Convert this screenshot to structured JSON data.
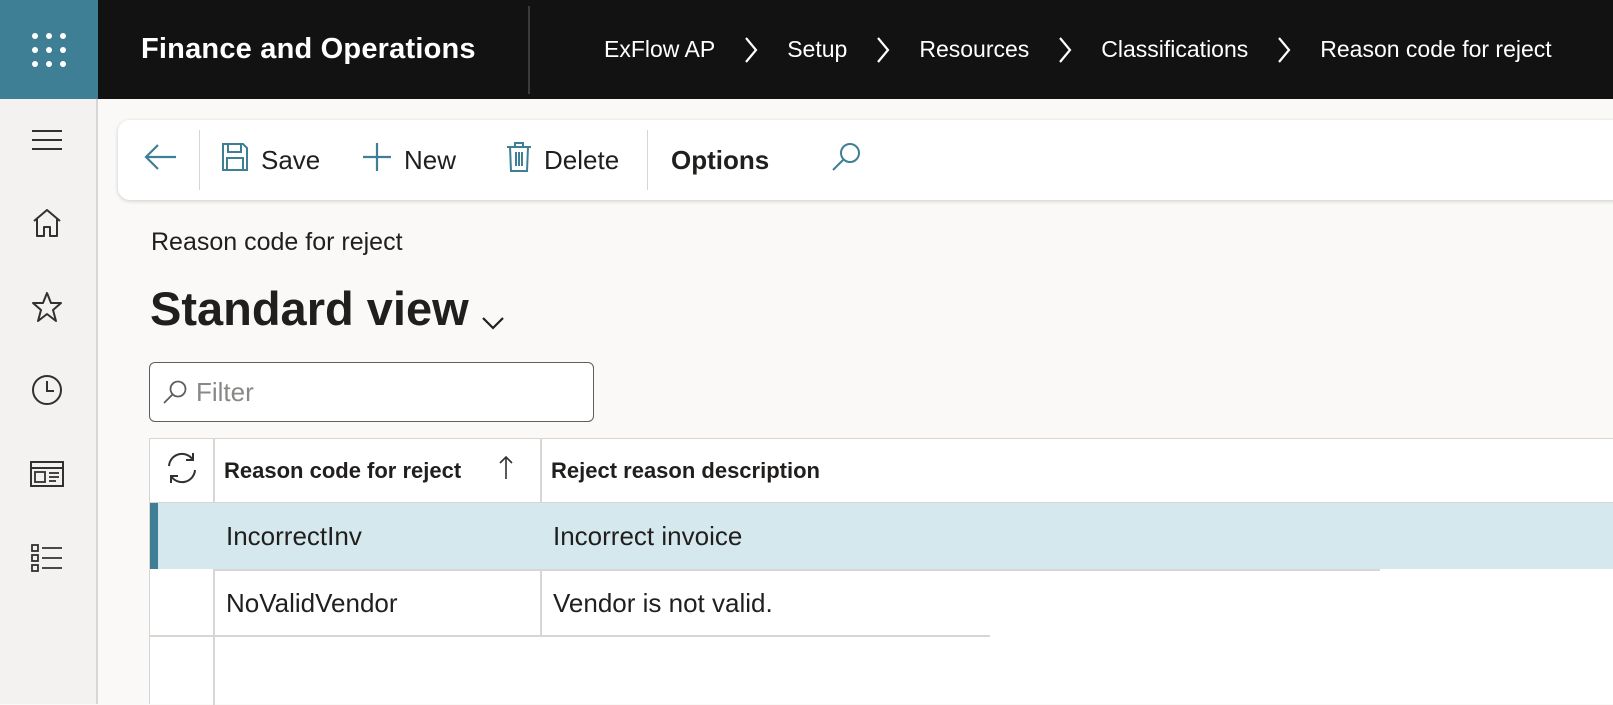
{
  "header": {
    "app_title": "Finance and Operations",
    "breadcrumb": [
      "ExFlow AP",
      "Setup",
      "Resources",
      "Classifications",
      "Reason code for reject"
    ]
  },
  "leftnav": {
    "items": [
      "hamburger-icon",
      "home-icon",
      "star-icon",
      "clock-icon",
      "workspace-icon",
      "modules-icon"
    ]
  },
  "actions": {
    "back_icon": "back-arrow-icon",
    "save_label": "Save",
    "new_label": "New",
    "delete_label": "Delete",
    "options_label": "Options",
    "search_icon": "search-icon"
  },
  "page": {
    "subtitle": "Reason code for reject",
    "view_title": "Standard view"
  },
  "filter": {
    "placeholder": "Filter",
    "value": ""
  },
  "grid": {
    "columns": [
      "Reason code for reject",
      "Reject reason description"
    ],
    "sort_column": 0,
    "rows": [
      {
        "code": "IncorrectInv",
        "description": "Incorrect invoice",
        "selected": true
      },
      {
        "code": "NoValidVendor",
        "description": "Vendor is not valid.",
        "selected": false
      }
    ]
  },
  "colors": {
    "waffle_bg": "#3f7f96",
    "topbar_bg": "#121212",
    "selected_row": "#d5e8ed",
    "accent": "#3f7f96"
  }
}
